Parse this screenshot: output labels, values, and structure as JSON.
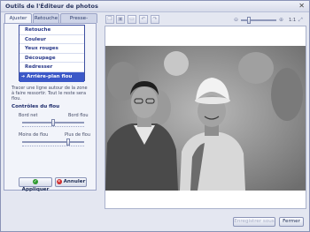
{
  "window": {
    "title": "Outils de l'Éditeur de photos",
    "close_glyph": "✕"
  },
  "tabs": [
    {
      "label": "Ajuster",
      "active": true
    },
    {
      "label": "Retouche",
      "active": false
    },
    {
      "label": "Presse-papiers",
      "active": false
    }
  ],
  "menu": {
    "items": [
      {
        "label": "Retouche"
      },
      {
        "label": "Couleur"
      },
      {
        "label": "Yeux rouges"
      },
      {
        "label": "Découpage"
      },
      {
        "label": "Redresser"
      },
      {
        "label": "Arrière-plan flou",
        "selected": true
      }
    ],
    "selected_arrow": "➔"
  },
  "description": "Tracer une ligne autour de la zone à faire ressortir. Tout le reste sera flou.",
  "blur_controls": {
    "title": "Contrôles du flou",
    "edge": {
      "left_label": "Bord net",
      "right_label": "Bord flou",
      "value": 0.5
    },
    "amount": {
      "left_label": "Moins de flou",
      "right_label": "Plus de flou",
      "value": 0.75
    }
  },
  "buttons": {
    "apply": "Appliquer",
    "cancel": "Annuler",
    "save_as": "Enregistrer sous",
    "close": "Fermer"
  },
  "zoom": {
    "value": 0.2,
    "fit_label": "1:1"
  },
  "colors": {
    "accent": "#3b58c8",
    "apply_icon": "#2e9a2e",
    "cancel_icon": "#cc2a2a"
  }
}
